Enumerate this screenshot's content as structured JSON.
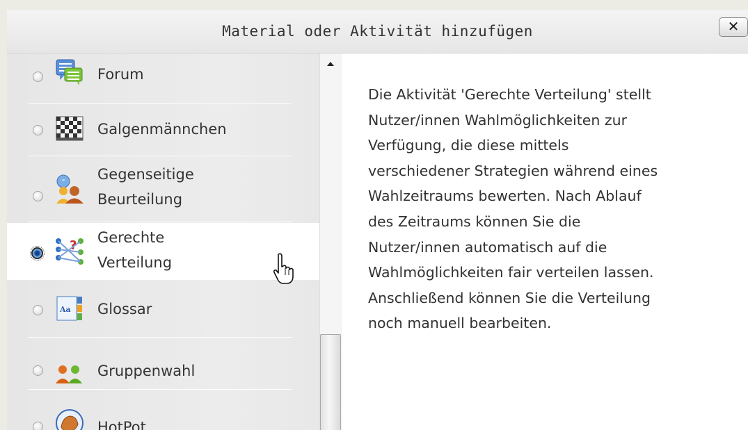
{
  "dialog": {
    "title": "Material oder Aktivität hinzufügen",
    "close_label": "✕"
  },
  "options": [
    {
      "lines": [
        "Forum"
      ],
      "icon": "forum-icon",
      "selected": false
    },
    {
      "lines": [
        "Galgenmännchen"
      ],
      "icon": "hangman-icon",
      "selected": false
    },
    {
      "lines": [
        "Gegenseitige",
        "Beurteilung"
      ],
      "icon": "peer-review-icon",
      "selected": false
    },
    {
      "lines": [
        "Gerechte",
        "Verteilung"
      ],
      "icon": "fair-allocation-icon",
      "selected": true
    },
    {
      "lines": [
        "Glossar"
      ],
      "icon": "glossary-icon",
      "selected": false
    },
    {
      "lines": [
        "Gruppenwahl"
      ],
      "icon": "group-choice-icon",
      "selected": false
    },
    {
      "lines": [
        "HotPot"
      ],
      "icon": "hotpot-icon",
      "selected": false
    }
  ],
  "description": {
    "lines": [
      "Die Aktivität 'Gerechte Verteilung' stellt",
      "Nutzer/innen Wahlmöglichkeiten zur",
      "Verfügung, die diese mittels",
      "verschiedener Strategien während eines",
      "Wahlzeitraums bewerten. Nach Ablauf",
      "des Zeitraums können Sie die",
      "Nutzer/innen automatisch auf die",
      "Wahlmöglichkeiten fair verteilen lassen.",
      "Anschließend können Sie die Verteilung",
      "noch manuell bearbeiten."
    ]
  },
  "colors": {
    "panel": "#ececec",
    "selected_row": "#ffffff",
    "text": "#333333"
  }
}
